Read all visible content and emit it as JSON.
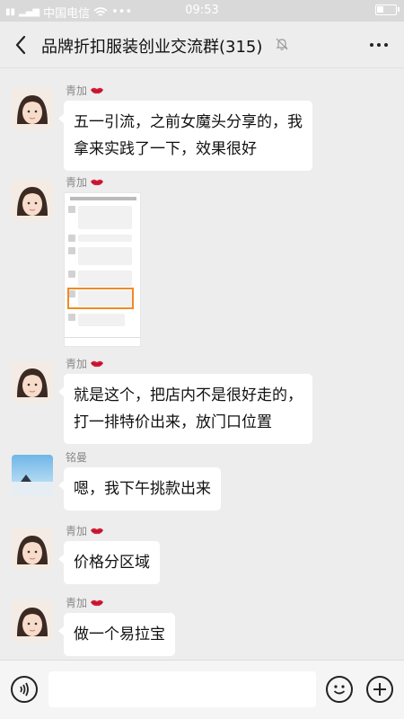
{
  "status_bar": {
    "carrier": "中国电信",
    "time": "09:53",
    "icons": [
      "sim-icon",
      "signal-icon",
      "wifi-icon",
      "more-icon",
      "battery-icon"
    ]
  },
  "header": {
    "title": "品牌折扣服装创业交流群(315)",
    "icons": [
      "back-icon",
      "mute-bell-icon",
      "more-dots-icon"
    ]
  },
  "messages": [
    {
      "sender": "青加",
      "type": "text",
      "lines": [
        "五一引流，之前女魔头分享的，我",
        "拿来实践了一下，效果很好"
      ],
      "sender_icon": "lips-icon"
    },
    {
      "sender": "青加",
      "type": "image",
      "image": "screenshot-thumbnail",
      "sender_icon": "lips-icon"
    },
    {
      "sender": "青加",
      "type": "text",
      "lines": [
        "就是这个，把店内不是很好走的，",
        "打一排特价出来，放门口位置"
      ],
      "sender_icon": "lips-icon"
    },
    {
      "sender": "铭曼",
      "type": "text",
      "lines": [
        "嗯，我下午挑款出来"
      ]
    },
    {
      "sender": "青加",
      "type": "text",
      "lines": [
        "价格分区域"
      ],
      "sender_icon": "lips-icon"
    },
    {
      "sender": "青加",
      "type": "text",
      "lines": [
        "做一个易拉宝"
      ],
      "sender_icon": "lips-icon"
    }
  ],
  "input_bar": {
    "placeholder": "",
    "icons": [
      "voice-icon",
      "emoji-icon",
      "plus-icon"
    ]
  },
  "colors": {
    "background": "#ededed",
    "bubble": "#ffffff",
    "highlight": "#f08a24",
    "lips": "#d81e3c"
  }
}
